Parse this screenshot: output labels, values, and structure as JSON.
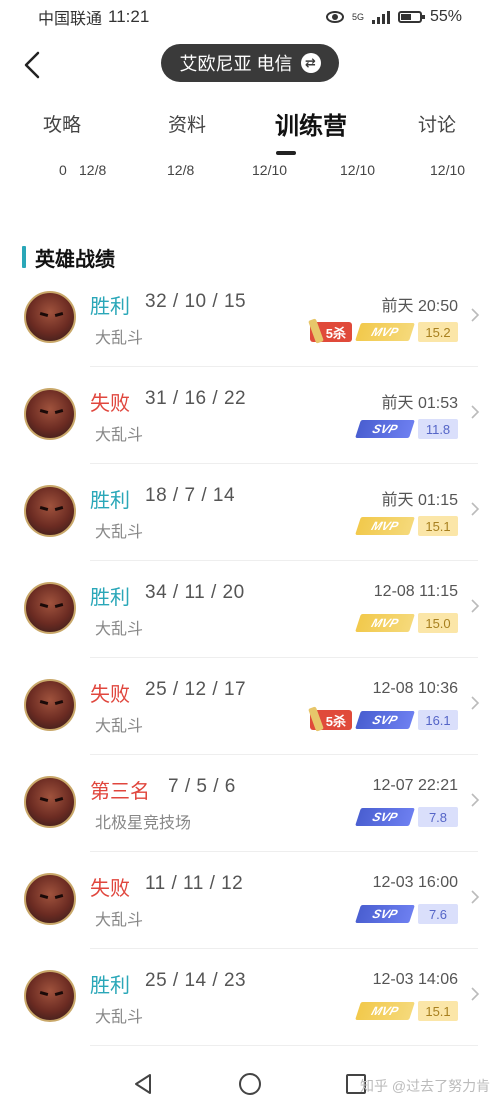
{
  "status_bar": {
    "carrier": "中国联通",
    "time": "11:21",
    "network": "5G",
    "battery": "55%"
  },
  "header": {
    "server": "艾欧尼亚 电信",
    "swap_glyph": "⇄"
  },
  "tabs": [
    {
      "label": "攻略",
      "date": "12/8",
      "count": "0"
    },
    {
      "label": "资料",
      "date": "12/8"
    },
    {
      "label": "训练营",
      "date": "12/10",
      "active": true
    },
    {
      "label": "",
      "date": "12/10"
    },
    {
      "label": "讨论",
      "date": "12/10"
    }
  ],
  "section": {
    "title": "英雄战绩"
  },
  "records": [
    {
      "result": "胜利",
      "outcome": "win",
      "kda": "32 / 10 / 15",
      "mode": "大乱斗",
      "time": "前天 20:50",
      "kill_badge": "5杀",
      "award": "MVP",
      "score": "15.2"
    },
    {
      "result": "失败",
      "outcome": "lose",
      "kda": "31 / 16 / 22",
      "mode": "大乱斗",
      "time": "前天 01:53",
      "award": "SVP",
      "score": "11.8"
    },
    {
      "result": "胜利",
      "outcome": "win",
      "kda": "18 / 7 / 14",
      "mode": "大乱斗",
      "time": "前天 01:15",
      "award": "MVP",
      "score": "15.1"
    },
    {
      "result": "胜利",
      "outcome": "win",
      "kda": "34 / 11 / 20",
      "mode": "大乱斗",
      "time": "12-08 11:15",
      "award": "MVP",
      "score": "15.0"
    },
    {
      "result": "失败",
      "outcome": "lose",
      "kda": "25 / 12 / 17",
      "mode": "大乱斗",
      "time": "12-08 10:36",
      "kill_badge": "5杀",
      "award": "SVP",
      "score": "16.1"
    },
    {
      "result": "第三名",
      "outcome": "lose",
      "kda": "7 / 5 / 6",
      "mode": "北极星竞技场",
      "time": "12-07 22:21",
      "award": "SVP",
      "score": "7.8"
    },
    {
      "result": "失败",
      "outcome": "lose",
      "kda": "11 / 11 / 12",
      "mode": "大乱斗",
      "time": "12-03 16:00",
      "award": "SVP",
      "score": "7.6"
    },
    {
      "result": "胜利",
      "outcome": "win",
      "kda": "25 / 14 / 23",
      "mode": "大乱斗",
      "time": "12-03 14:06",
      "award": "MVP",
      "score": "15.1"
    }
  ],
  "watermark": "知乎 @过去了努力肯",
  "colors": {
    "win": "#2aa7b8",
    "lose": "#e0463d",
    "mvp": "#f2c94c",
    "svp": "#4a5fd1"
  }
}
